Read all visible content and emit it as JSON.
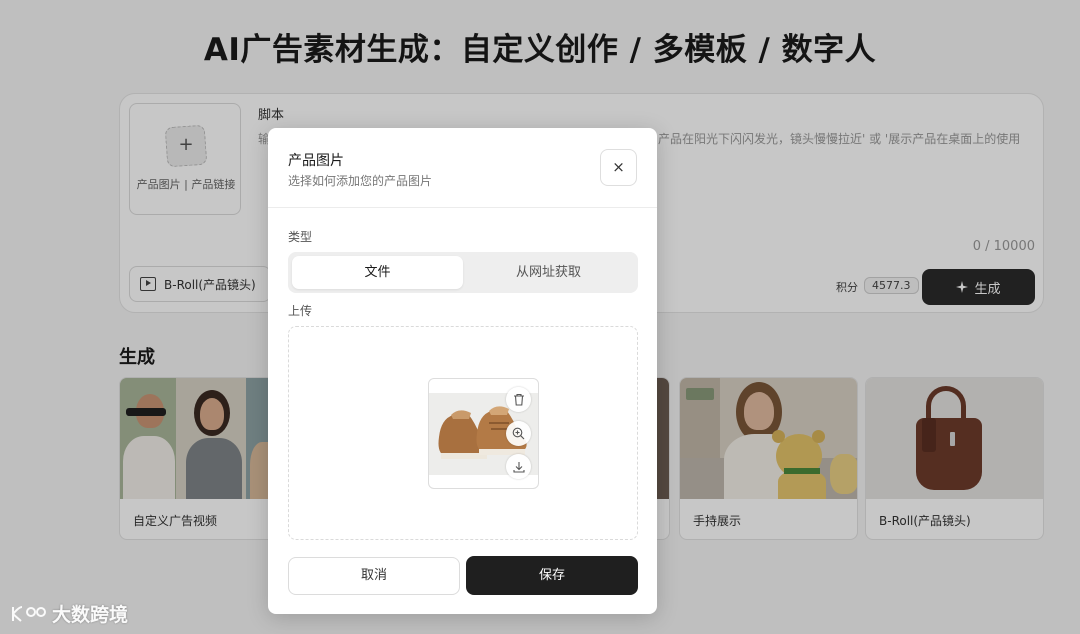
{
  "page": {
    "title": "AI广告素材生成：自定义创作 / 多模板 / 数字人"
  },
  "editor": {
    "upload_caption": "产品图片 | 产品链接",
    "upload_plus": "+",
    "script_label": "脚本",
    "script_hint_left": "输入",
    "script_hint_right": "产品在阳光下闪闪发光，镜头慢慢拉近' 或 '展示产品在桌面上的使用",
    "char_count": "0 / 10000",
    "mode_value": "B-Roll(产品镜头)",
    "credits_label": "积分",
    "credits_value": "4577.3",
    "generate_label": "生成"
  },
  "gallery": {
    "title": "生成",
    "cards": [
      {
        "label": "自定义广告视频"
      },
      {
        "label": "手持展示"
      },
      {
        "label": "B-Roll(产品镜头)"
      }
    ]
  },
  "modal": {
    "title": "产品图片",
    "subtitle": "选择如何添加您的产品图片",
    "close_glyph": "×",
    "type_label": "类型",
    "tabs": [
      "文件",
      "从网址获取"
    ],
    "upload_label": "上传",
    "cancel_label": "取消",
    "save_label": "保存"
  },
  "watermark": {
    "text": "大数跨境"
  },
  "icons": {
    "upload": "plus-icon",
    "mode": "film-icon",
    "generate": "sparkle-icon",
    "close": "close-icon",
    "delete": "trash-icon",
    "zoom": "zoom-in-icon",
    "download": "download-icon"
  },
  "colors": {
    "primary_button": "#1f1f1f",
    "background": "#f5f5f5",
    "segment_active": "#ffffff"
  }
}
